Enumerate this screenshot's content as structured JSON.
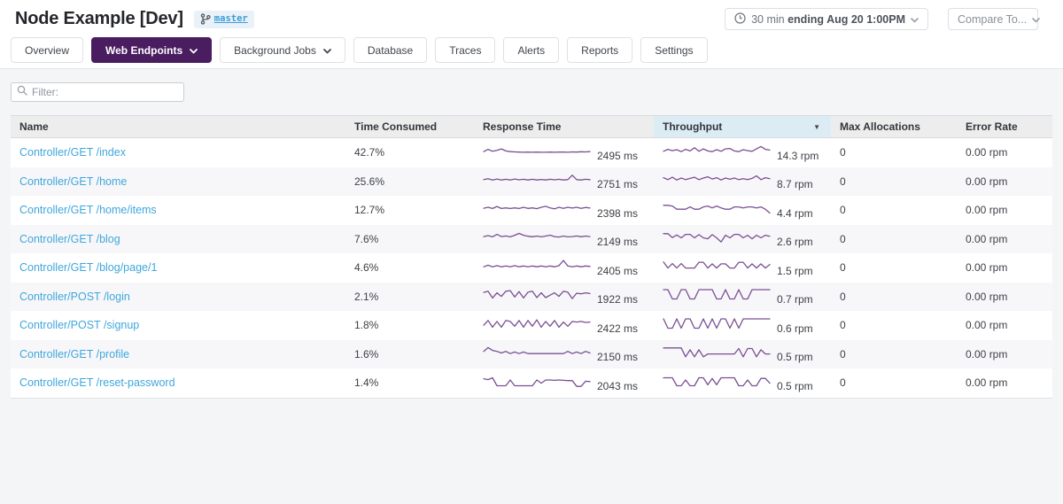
{
  "header": {
    "title": "Node Example [Dev]",
    "branch": {
      "label": "master"
    },
    "time_picker": {
      "prefix": "30 min ",
      "bold": "ending Aug 20 1:00PM"
    },
    "compare_label": "Compare To..."
  },
  "tabs": [
    {
      "label": "Overview",
      "active": false,
      "chevron": false
    },
    {
      "label": "Web Endpoints",
      "active": true,
      "chevron": true
    },
    {
      "label": "Background Jobs",
      "active": false,
      "chevron": true
    },
    {
      "label": "Database",
      "active": false,
      "chevron": false
    },
    {
      "label": "Traces",
      "active": false,
      "chevron": false
    },
    {
      "label": "Alerts",
      "active": false,
      "chevron": false
    },
    {
      "label": "Reports",
      "active": false,
      "chevron": false
    },
    {
      "label": "Settings",
      "active": false,
      "chevron": false
    }
  ],
  "filter": {
    "placeholder": "Filter:"
  },
  "table": {
    "columns": [
      {
        "label": "Name"
      },
      {
        "label": "Time Consumed"
      },
      {
        "label": "Response Time"
      },
      {
        "label": "Throughput",
        "sorted": true
      },
      {
        "label": "Max Allocations"
      },
      {
        "label": "Error Rate"
      }
    ],
    "sort_indicator": "▼",
    "sorted_column": "Throughput",
    "rows": [
      {
        "name": "Controller/GET /index",
        "time_consumed": "42.7%",
        "response_time": "2495 ms",
        "throughput": "14.3 rpm",
        "max_allocations": "0",
        "error_rate": "0.00 rpm",
        "rt_spark": [
          0.38,
          0.52,
          0.4,
          0.46,
          0.55,
          0.42,
          0.38,
          0.36,
          0.35,
          0.34,
          0.35,
          0.34,
          0.35,
          0.34,
          0.34,
          0.35,
          0.34,
          0.35,
          0.35,
          0.34,
          0.36,
          0.35,
          0.37,
          0.36,
          0.38
        ],
        "tp_spark": [
          0.4,
          0.52,
          0.44,
          0.5,
          0.38,
          0.52,
          0.42,
          0.62,
          0.4,
          0.55,
          0.42,
          0.38,
          0.5,
          0.4,
          0.55,
          0.58,
          0.42,
          0.38,
          0.5,
          0.44,
          0.4,
          0.55,
          0.7,
          0.52,
          0.48
        ]
      },
      {
        "name": "Controller/GET /home",
        "time_consumed": "25.6%",
        "response_time": "2751 ms",
        "throughput": "8.7 rpm",
        "max_allocations": "0",
        "error_rate": "0.00 rpm",
        "rt_spark": [
          0.4,
          0.46,
          0.38,
          0.44,
          0.38,
          0.42,
          0.38,
          0.44,
          0.39,
          0.42,
          0.38,
          0.42,
          0.38,
          0.41,
          0.38,
          0.42,
          0.39,
          0.42,
          0.38,
          0.4,
          0.68,
          0.4,
          0.38,
          0.42,
          0.4
        ],
        "tp_spark": [
          0.52,
          0.4,
          0.55,
          0.38,
          0.5,
          0.4,
          0.48,
          0.55,
          0.4,
          0.5,
          0.58,
          0.44,
          0.52,
          0.38,
          0.5,
          0.42,
          0.5,
          0.4,
          0.46,
          0.4,
          0.48,
          0.64,
          0.4,
          0.52,
          0.46
        ]
      },
      {
        "name": "Controller/GET /home/items",
        "time_consumed": "12.7%",
        "response_time": "2398 ms",
        "throughput": "4.4 rpm",
        "max_allocations": "0",
        "error_rate": "0.00 rpm",
        "rt_spark": [
          0.44,
          0.5,
          0.42,
          0.55,
          0.42,
          0.46,
          0.42,
          0.46,
          0.42,
          0.5,
          0.43,
          0.46,
          0.41,
          0.5,
          0.56,
          0.46,
          0.4,
          0.5,
          0.43,
          0.5,
          0.45,
          0.5,
          0.43,
          0.49,
          0.45
        ],
        "tp_spark": [
          0.62,
          0.62,
          0.58,
          0.38,
          0.38,
          0.38,
          0.52,
          0.38,
          0.38,
          0.52,
          0.58,
          0.46,
          0.58,
          0.46,
          0.38,
          0.38,
          0.52,
          0.52,
          0.46,
          0.52,
          0.52,
          0.46,
          0.52,
          0.38,
          0.14
        ]
      },
      {
        "name": "Controller/GET /blog",
        "time_consumed": "7.6%",
        "response_time": "2149 ms",
        "throughput": "2.6 rpm",
        "max_allocations": "0",
        "error_rate": "0.00 rpm",
        "rt_spark": [
          0.44,
          0.5,
          0.42,
          0.58,
          0.44,
          0.48,
          0.42,
          0.52,
          0.64,
          0.52,
          0.46,
          0.43,
          0.47,
          0.42,
          0.47,
          0.53,
          0.44,
          0.41,
          0.47,
          0.42,
          0.44,
          0.48,
          0.43,
          0.47,
          0.44
        ],
        "tp_spark": [
          0.62,
          0.62,
          0.38,
          0.54,
          0.36,
          0.58,
          0.58,
          0.36,
          0.56,
          0.36,
          0.3,
          0.56,
          0.36,
          0.1,
          0.52,
          0.36,
          0.58,
          0.58,
          0.36,
          0.52,
          0.3,
          0.52,
          0.36,
          0.52,
          0.46
        ]
      },
      {
        "name": "Controller/GET /blog/page/1",
        "time_consumed": "4.6%",
        "response_time": "2405 ms",
        "throughput": "1.5 rpm",
        "max_allocations": "0",
        "error_rate": "0.00 rpm",
        "rt_spark": [
          0.38,
          0.48,
          0.37,
          0.45,
          0.37,
          0.43,
          0.37,
          0.45,
          0.38,
          0.43,
          0.37,
          0.43,
          0.38,
          0.43,
          0.37,
          0.43,
          0.38,
          0.45,
          0.78,
          0.43,
          0.37,
          0.43,
          0.38,
          0.43,
          0.4
        ],
        "tp_spark": [
          0.68,
          0.3,
          0.58,
          0.3,
          0.58,
          0.3,
          0.3,
          0.3,
          0.66,
          0.66,
          0.3,
          0.56,
          0.3,
          0.56,
          0.56,
          0.3,
          0.3,
          0.66,
          0.66,
          0.3,
          0.56,
          0.3,
          0.56,
          0.3,
          0.52
        ]
      },
      {
        "name": "Controller/POST /login",
        "time_consumed": "2.1%",
        "response_time": "1922 ms",
        "throughput": "0.7 rpm",
        "max_allocations": "0",
        "error_rate": "0.00 rpm",
        "rt_spark": [
          0.55,
          0.62,
          0.2,
          0.52,
          0.3,
          0.62,
          0.66,
          0.26,
          0.6,
          0.2,
          0.56,
          0.62,
          0.22,
          0.52,
          0.22,
          0.38,
          0.52,
          0.3,
          0.62,
          0.56,
          0.16,
          0.5,
          0.46,
          0.52,
          0.48
        ],
        "tp_spark": [
          0.72,
          0.72,
          0.14,
          0.14,
          0.72,
          0.72,
          0.14,
          0.14,
          0.72,
          0.72,
          0.72,
          0.72,
          0.14,
          0.14,
          0.72,
          0.14,
          0.14,
          0.72,
          0.14,
          0.14,
          0.72,
          0.72,
          0.72,
          0.72,
          0.72
        ]
      },
      {
        "name": "Controller/POST /signup",
        "time_consumed": "1.8%",
        "response_time": "2422 ms",
        "throughput": "0.6 rpm",
        "max_allocations": "0",
        "error_rate": "0.00 rpm",
        "rt_spark": [
          0.32,
          0.62,
          0.2,
          0.56,
          0.2,
          0.62,
          0.56,
          0.26,
          0.62,
          0.2,
          0.62,
          0.26,
          0.66,
          0.2,
          0.56,
          0.26,
          0.62,
          0.2,
          0.52,
          0.26,
          0.56,
          0.52,
          0.56,
          0.5,
          0.52
        ],
        "tp_spark": [
          0.72,
          0.14,
          0.14,
          0.72,
          0.14,
          0.72,
          0.72,
          0.14,
          0.14,
          0.72,
          0.14,
          0.72,
          0.14,
          0.72,
          0.72,
          0.14,
          0.72,
          0.14,
          0.72,
          0.72,
          0.72,
          0.72,
          0.72,
          0.72,
          0.72
        ]
      },
      {
        "name": "Controller/GET /profile",
        "time_consumed": "1.6%",
        "response_time": "2150 ms",
        "throughput": "0.5 rpm",
        "max_allocations": "0",
        "error_rate": "0.00 rpm",
        "rt_spark": [
          0.46,
          0.7,
          0.52,
          0.46,
          0.36,
          0.46,
          0.32,
          0.42,
          0.32,
          0.42,
          0.32,
          0.32,
          0.32,
          0.32,
          0.32,
          0.32,
          0.32,
          0.32,
          0.32,
          0.46,
          0.32,
          0.42,
          0.32,
          0.46,
          0.36
        ],
        "tp_spark": [
          0.68,
          0.68,
          0.68,
          0.68,
          0.68,
          0.12,
          0.56,
          0.12,
          0.56,
          0.12,
          0.3,
          0.3,
          0.3,
          0.3,
          0.3,
          0.3,
          0.3,
          0.64,
          0.12,
          0.64,
          0.64,
          0.12,
          0.56,
          0.3,
          0.3
        ]
      },
      {
        "name": "Controller/GET /reset-password",
        "time_consumed": "1.4%",
        "response_time": "2043 ms",
        "throughput": "0.5 rpm",
        "max_allocations": "0",
        "error_rate": "0.00 rpm",
        "rt_spark": [
          0.58,
          0.52,
          0.64,
          0.14,
          0.14,
          0.14,
          0.5,
          0.14,
          0.14,
          0.14,
          0.14,
          0.14,
          0.5,
          0.3,
          0.5,
          0.5,
          0.48,
          0.5,
          0.48,
          0.46,
          0.46,
          0.1,
          0.1,
          0.42,
          0.4
        ],
        "tp_spark": [
          0.64,
          0.64,
          0.64,
          0.14,
          0.14,
          0.5,
          0.14,
          0.14,
          0.64,
          0.64,
          0.2,
          0.6,
          0.2,
          0.64,
          0.64,
          0.64,
          0.64,
          0.14,
          0.14,
          0.5,
          0.14,
          0.14,
          0.6,
          0.6,
          0.3
        ]
      }
    ]
  },
  "colors": {
    "accent_purple": "#4a1c60",
    "link_blue": "#3fa7dc",
    "sparkline_purple": "#7a4f93",
    "sorted_header_bg": "#dcecf4",
    "table_header_bg": "#ededee",
    "row_alt_bg": "#f7f7f9",
    "page_bg": "#f4f5f7"
  }
}
